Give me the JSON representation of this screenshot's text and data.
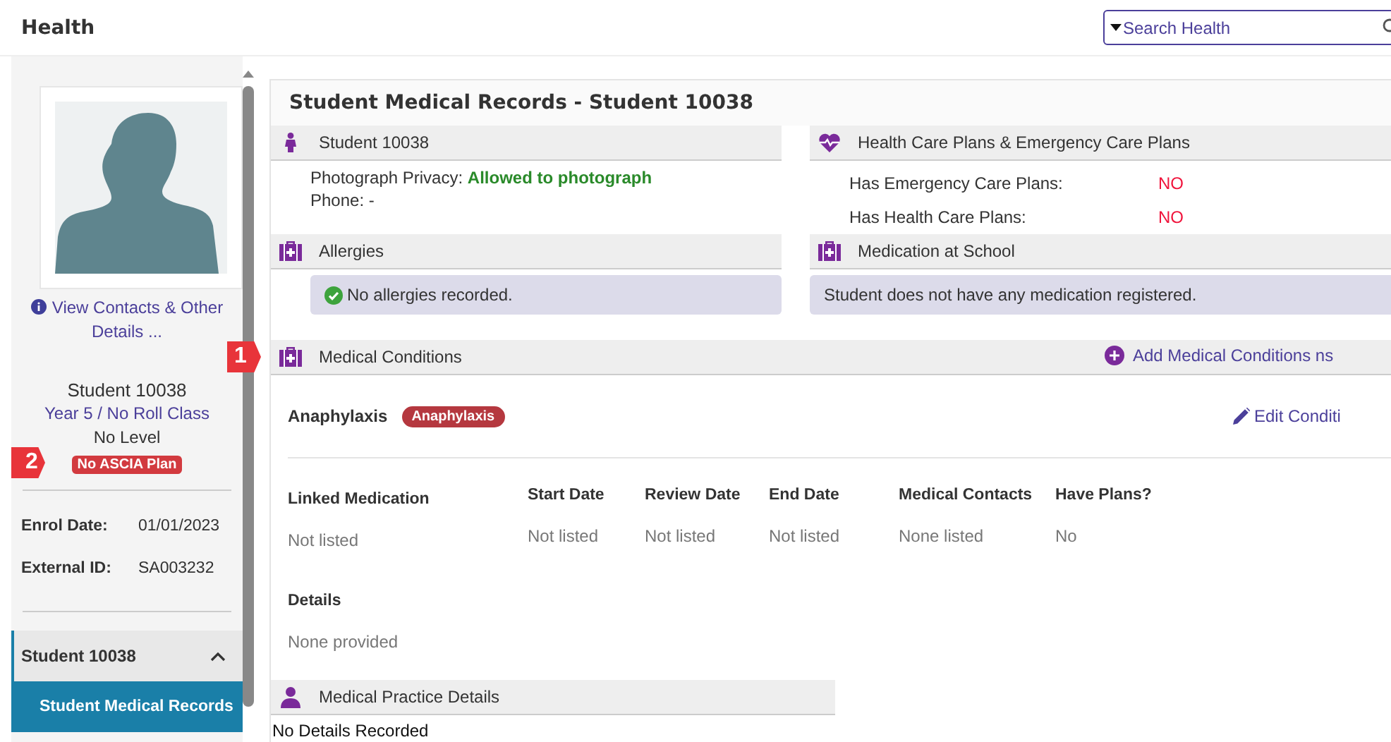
{
  "header": {
    "title": "Health",
    "search": {
      "placeholder": "Search Health"
    }
  },
  "sidebar": {
    "contacts_link": "View Contacts & Other Details ...",
    "student_name": "Student 10038",
    "class": "Year 5 / No Roll Class",
    "level": "No Level",
    "badge": "No ASCIA Plan",
    "callout": "2",
    "fields": [
      {
        "label": "Enrol Date:",
        "value": "01/01/2023"
      },
      {
        "label": "External ID:",
        "value": "SA003232"
      }
    ],
    "nav": {
      "group": "Student 10038",
      "expanded": true,
      "items": [
        {
          "label": "Student Medical Records",
          "selected": true
        }
      ]
    }
  },
  "record": {
    "title": "Student Medical Records - Student 10038",
    "student": {
      "heading": "Student 10038",
      "privacy_label": "Photograph Privacy:",
      "privacy_value": "Allowed to photograph",
      "phone": "Phone: -"
    },
    "plans": {
      "heading": "Health Care Plans & Emergency Care Plans",
      "rows": [
        {
          "label": "Has Emergency Care Plans:",
          "value": "NO"
        },
        {
          "label": "Has Health Care Plans:",
          "value": "NO"
        }
      ]
    },
    "allergies": {
      "heading": "Allergies",
      "message": "No allergies recorded."
    },
    "medication": {
      "heading": "Medication at School",
      "message": "Student does not have any medication registered."
    },
    "conditions": {
      "heading": "Medical Conditions",
      "callout": "1",
      "add_link": "Add Medical Conditions ns",
      "items": [
        {
          "name": "Anaphylaxis",
          "tag": "Anaphylaxis",
          "edit_link": "Edit Conditi",
          "columns": [
            {
              "label": "Linked Medication",
              "value": "Not listed"
            },
            {
              "label": "Start Date",
              "value": "Not listed"
            },
            {
              "label": "Review Date",
              "value": "Not listed"
            },
            {
              "label": "End Date",
              "value": "Not listed"
            },
            {
              "label": "Medical Contacts",
              "value": "None listed"
            },
            {
              "label": "Have Plans?",
              "value": "No"
            }
          ],
          "details_label": "Details",
          "details": "None provided"
        }
      ]
    },
    "practice": {
      "heading": "Medical Practice Details",
      "message": "No Details Recorded"
    }
  }
}
